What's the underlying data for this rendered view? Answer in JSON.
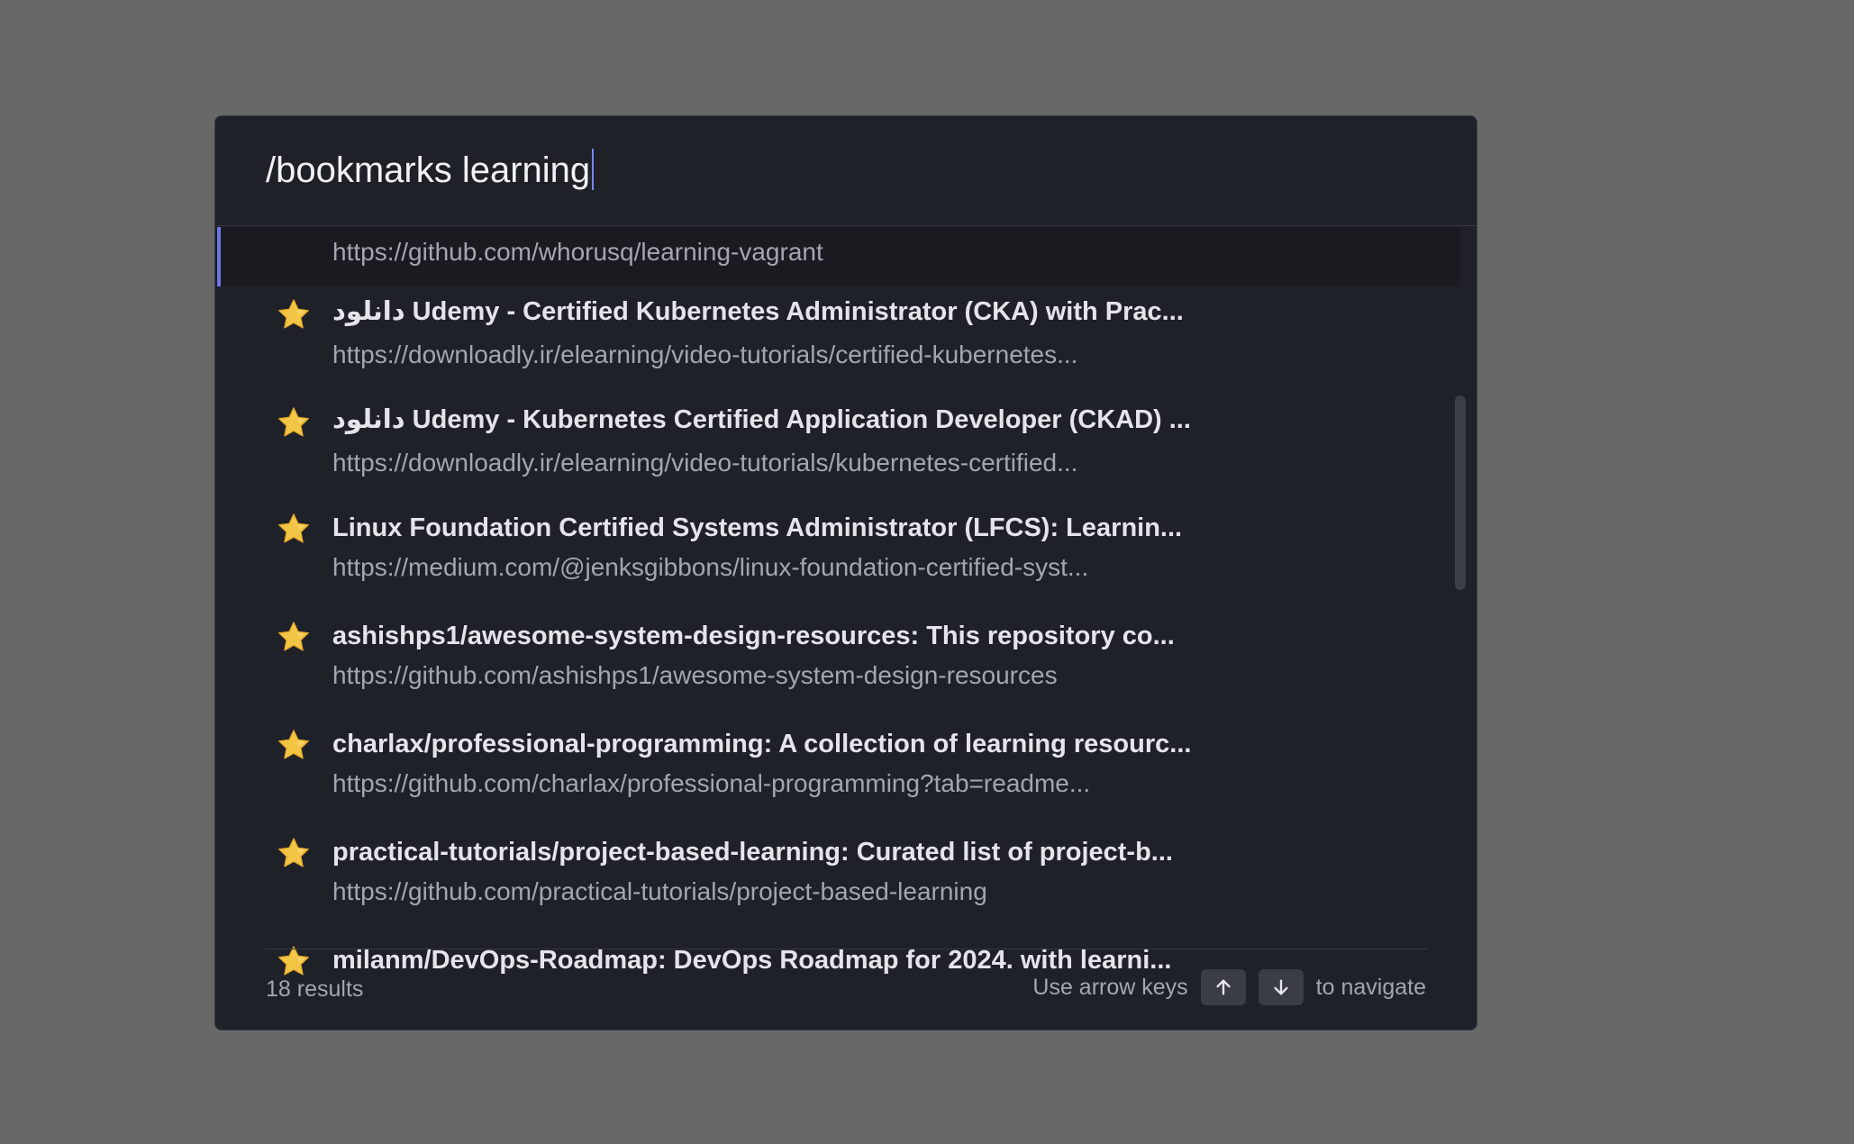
{
  "search": {
    "query": "/bookmarks learning"
  },
  "results": [
    {
      "title": "",
      "url": "https://github.com/whorusq/learning-vagrant",
      "selected": true
    },
    {
      "title": "دانلود Udemy - Certified Kubernetes Administrator (CKA) with Prac...",
      "url": "https://downloadly.ir/elearning/video-tutorials/certified-kubernetes...",
      "icon": "star-icon"
    },
    {
      "title": "دانلود Udemy - Kubernetes Certified Application Developer (CKAD) ...",
      "url": "https://downloadly.ir/elearning/video-tutorials/kubernetes-certified...",
      "icon": "star-icon"
    },
    {
      "title": "Linux Foundation Certified Systems Administrator (LFCS): Learnin...",
      "url": "https://medium.com/@jenksgibbons/linux-foundation-certified-syst...",
      "icon": "star-icon"
    },
    {
      "title": "ashishps1/awesome-system-design-resources: This repository co...",
      "url": "https://github.com/ashishps1/awesome-system-design-resources",
      "icon": "star-icon"
    },
    {
      "title": "charlax/professional-programming: A collection of learning resourc...",
      "url": "https://github.com/charlax/professional-programming?tab=readme...",
      "icon": "star-icon"
    },
    {
      "title": "practical-tutorials/project-based-learning: Curated list of project-b...",
      "url": "https://github.com/practical-tutorials/project-based-learning",
      "icon": "star-icon"
    },
    {
      "title": "milanm/DevOps-Roadmap: DevOps Roadmap for 2024. with learni...",
      "url": "",
      "icon": "star-icon"
    }
  ],
  "footer": {
    "count": "18 results",
    "hint_prefix": "Use arrow keys",
    "hint_suffix": "to navigate",
    "up_key_icon": "arrow-up-icon",
    "down_key_icon": "arrow-down-icon"
  },
  "colors": {
    "backdrop": "#686868",
    "panel": "#1f2129",
    "accent": "#6d73e8",
    "star": "#f3c545"
  }
}
